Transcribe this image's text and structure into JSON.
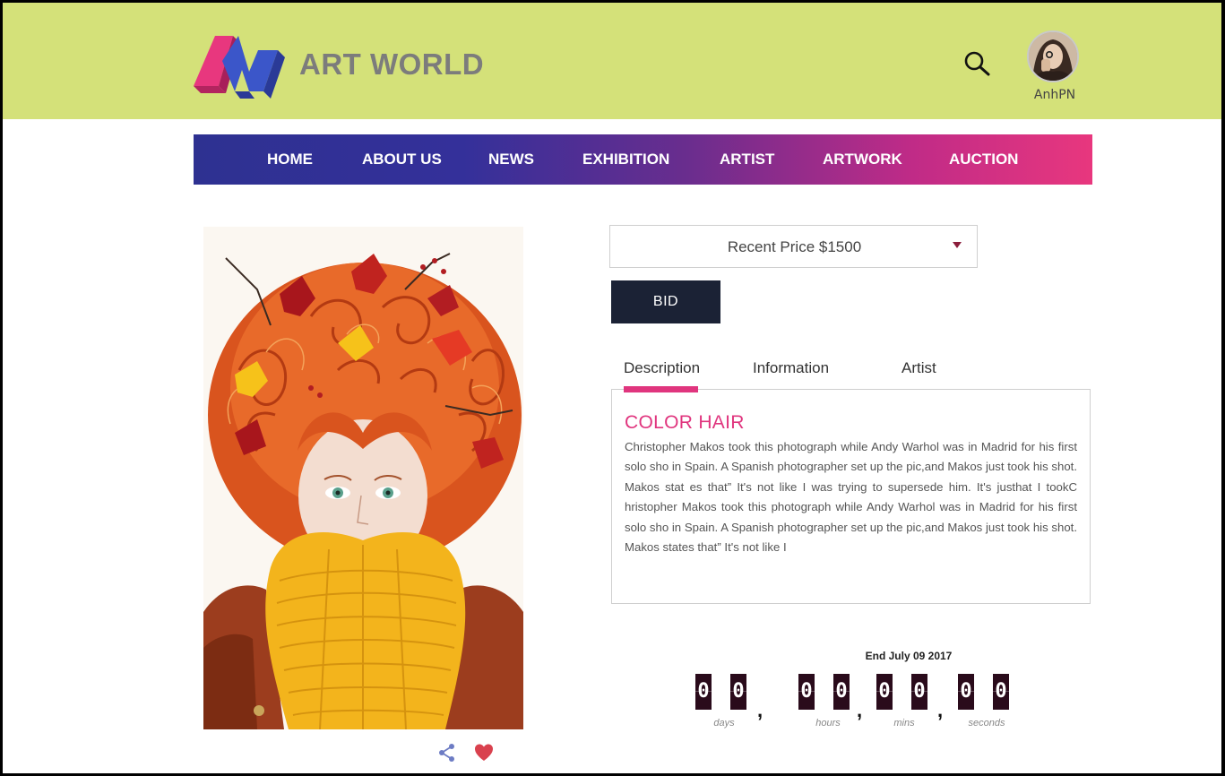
{
  "header": {
    "brand": "ART WORLD",
    "username": "AnhPN"
  },
  "nav": {
    "items": [
      "HOME",
      "ABOUT US",
      "NEWS",
      "EXHIBITION",
      "ARTIST",
      "ARTWORK",
      "AUCTION"
    ]
  },
  "auction": {
    "price_label": "Recent Price $1500",
    "bid_label": "BID"
  },
  "tabs": [
    "Description",
    "Information",
    "Artist"
  ],
  "description": {
    "title": "COLOR HAIR",
    "text": "Christopher Makos took this photograph while Andy Warhol was in Madrid for his first solo sho in Spain. A Spanish photographer set up the pic,and Makos just took his shot. Makos stat es that” It's not like I was trying to supersede him. It's justhat I tookC hristopher Makos took this photograph while Andy Warhol was in Madrid for his first solo sho in Spain. A Spanish photographer set up the pic,and Makos just took his shot. Makos states that” It's not like I"
  },
  "countdown": {
    "end_label": "End July 09 2017",
    "days": [
      "0",
      "0"
    ],
    "hours": [
      "0",
      "0"
    ],
    "mins": [
      "0",
      "0"
    ],
    "seconds": [
      "0",
      "0"
    ],
    "labels": {
      "days": "days",
      "hours": "hours",
      "mins": "mins",
      "seconds": "seconds"
    }
  },
  "colors": {
    "header_bg": "#d4e179",
    "accent_pink": "#e0357e",
    "nav_start": "#2e3191",
    "nav_end": "#e8377e",
    "button_dark": "#1b2235"
  },
  "icons": [
    "search-icon",
    "share-icon",
    "heart-icon",
    "dropdown-caret-icon"
  ]
}
